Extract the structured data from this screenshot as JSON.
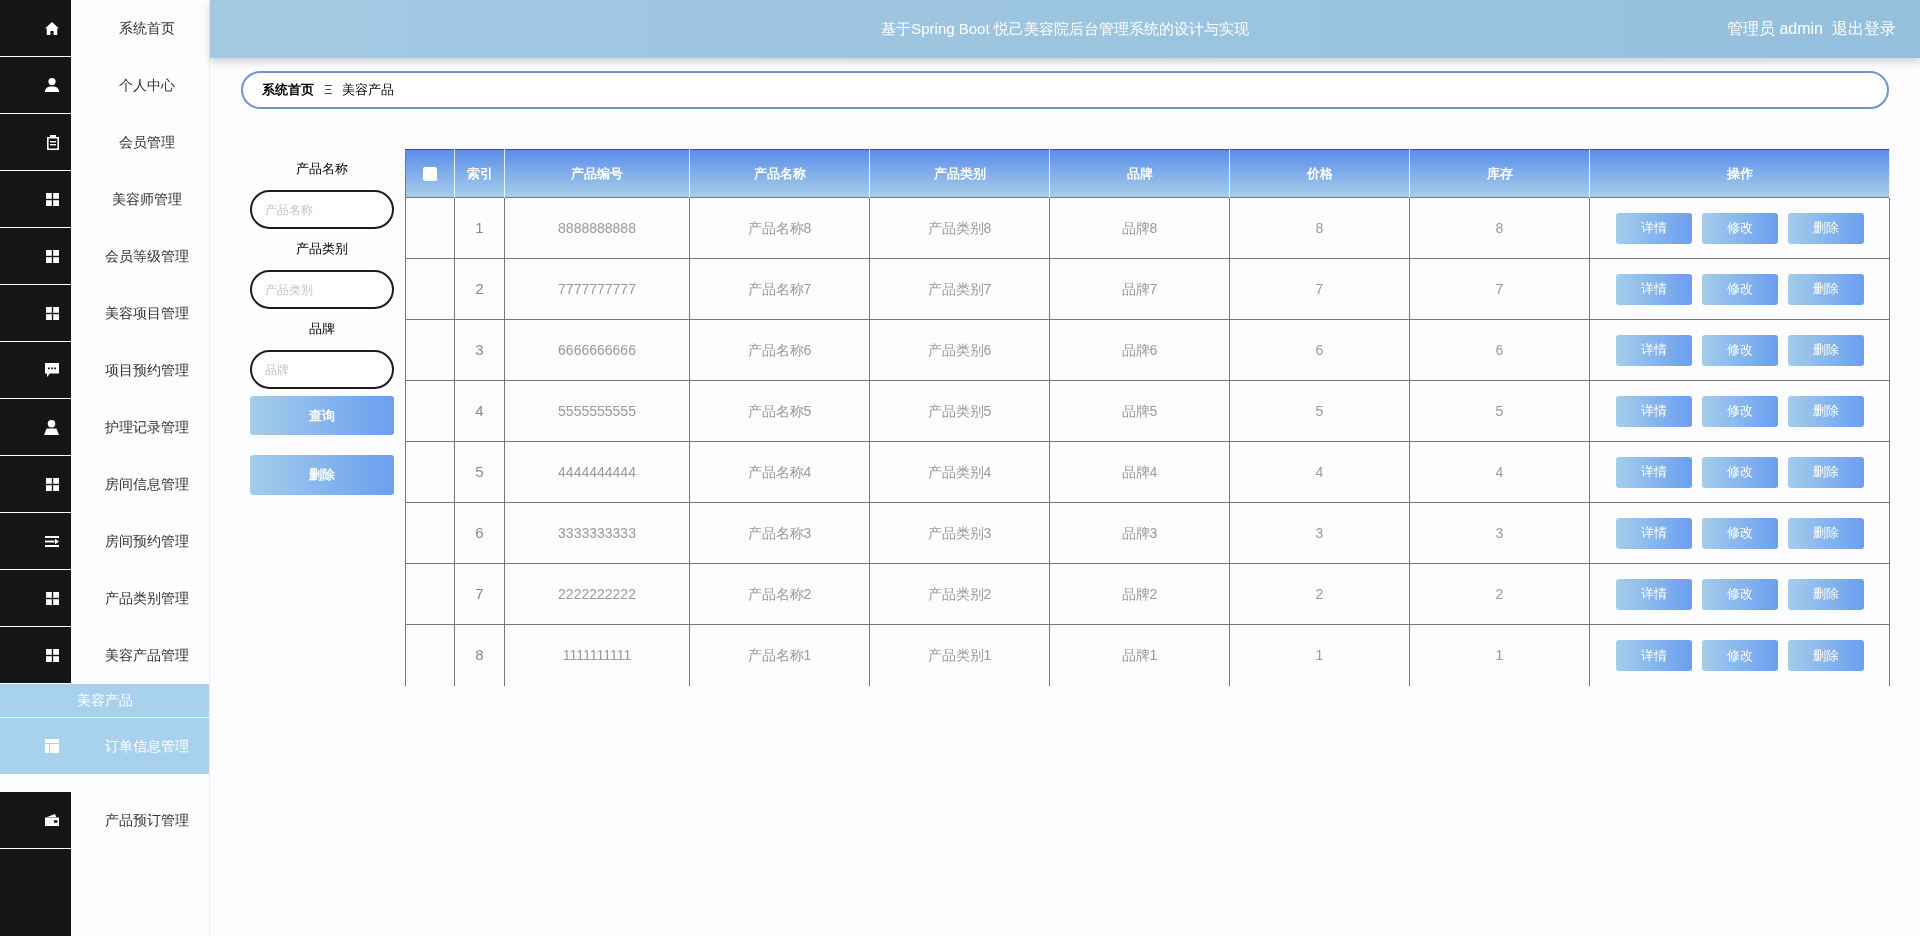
{
  "header": {
    "title": "基于Spring Boot 悦己美容院后台管理系统的设计与实现",
    "user": "管理员 admin",
    "logout": "退出登录"
  },
  "sidebar": {
    "items": [
      {
        "kind": "home",
        "label": "系统首页"
      },
      {
        "kind": "user",
        "label": "个人中心"
      },
      {
        "kind": "clipboard",
        "label": "会员管理"
      },
      {
        "kind": "grid",
        "label": "美容师管理"
      },
      {
        "kind": "grid",
        "label": "会员等级管理"
      },
      {
        "kind": "grid",
        "label": "美容项目管理"
      },
      {
        "kind": "chat",
        "label": "项目预约管理"
      },
      {
        "kind": "person",
        "label": "护理记录管理"
      },
      {
        "kind": "grid",
        "label": "房间信息管理"
      },
      {
        "kind": "list",
        "label": "房间预约管理"
      },
      {
        "kind": "grid",
        "label": "产品类别管理"
      },
      {
        "kind": "grid",
        "label": "美容产品管理"
      },
      {
        "kind": "group",
        "label": "美容产品",
        "expanded": true,
        "children": [
          {
            "kind": "table",
            "label": "订单信息管理"
          }
        ]
      },
      {
        "kind": "wallet",
        "label": "产品预订管理"
      }
    ]
  },
  "breadcrumb": {
    "items": [
      "系统首页",
      "美容产品"
    ],
    "separator": "Ξ"
  },
  "search": {
    "fields": [
      {
        "label": "产品名称",
        "placeholder": "产品名称"
      },
      {
        "label": "产品类别",
        "placeholder": "产品类别"
      },
      {
        "label": "品牌",
        "placeholder": "品牌"
      }
    ],
    "buttons": [
      "查询",
      "删除"
    ]
  },
  "table": {
    "select_all_checked": false,
    "columns": [
      "索引",
      "产品编号",
      "产品名称",
      "产品类别",
      "品牌",
      "价格",
      "库存",
      "操作"
    ],
    "rows": [
      {
        "cells": [
          "1",
          "8888888888",
          "产品名称8",
          "产品类别8",
          "品牌8",
          "8",
          "8"
        ],
        "actions": [
          "详情",
          "修改",
          "删除"
        ]
      },
      {
        "cells": [
          "2",
          "7777777777",
          "产品名称7",
          "产品类别7",
          "品牌7",
          "7",
          "7"
        ],
        "actions": [
          "详情",
          "修改",
          "删除"
        ]
      },
      {
        "cells": [
          "3",
          "6666666666",
          "产品名称6",
          "产品类别6",
          "品牌6",
          "6",
          "6"
        ],
        "actions": [
          "详情",
          "修改",
          "删除"
        ]
      },
      {
        "cells": [
          "4",
          "5555555555",
          "产品名称5",
          "产品类别5",
          "品牌5",
          "5",
          "5"
        ],
        "actions": [
          "详情",
          "修改",
          "删除"
        ]
      },
      {
        "cells": [
          "5",
          "4444444444",
          "产品名称4",
          "产品类别4",
          "品牌4",
          "4",
          "4"
        ],
        "actions": [
          "详情",
          "修改",
          "删除"
        ]
      },
      {
        "cells": [
          "6",
          "3333333333",
          "产品名称3",
          "产品类别3",
          "品牌3",
          "3",
          "3"
        ],
        "actions": [
          "详情",
          "修改",
          "删除"
        ]
      },
      {
        "cells": [
          "7",
          "2222222222",
          "产品名称2",
          "产品类别2",
          "品牌2",
          "2",
          "2"
        ],
        "actions": [
          "详情",
          "修改",
          "删除"
        ]
      },
      {
        "cells": [
          "8",
          "1111111111",
          "产品名称1",
          "产品类别1",
          "品牌1",
          "1",
          "1"
        ],
        "actions": [
          "详情",
          "修改",
          "删除"
        ]
      }
    ]
  }
}
